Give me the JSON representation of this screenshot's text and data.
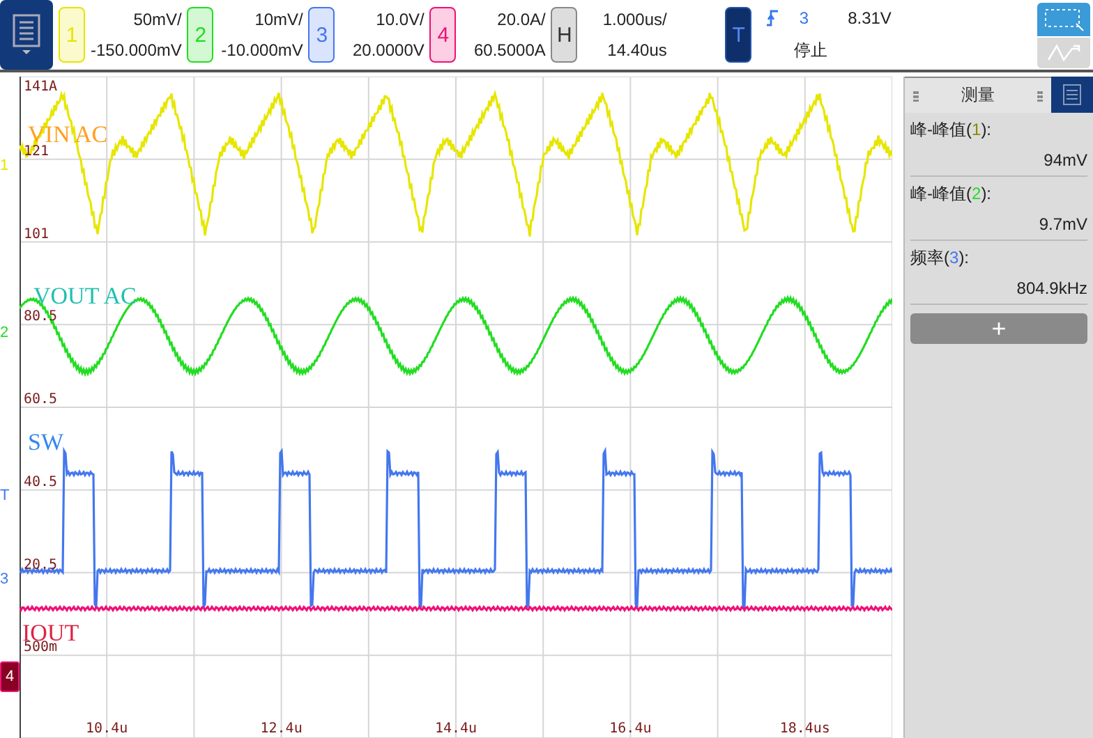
{
  "channels": [
    {
      "number": "1",
      "scale": "50mV/",
      "offset": "-150.000mV",
      "color": "#e6e600"
    },
    {
      "number": "2",
      "scale": "10mV/",
      "offset": "-10.000mV",
      "color": "#22dd22"
    },
    {
      "number": "3",
      "scale": "10.0V/",
      "offset": "20.0000V",
      "color": "#4477ee"
    },
    {
      "number": "4",
      "scale": "20.0A/",
      "offset": "60.5000A",
      "color": "#ee1177"
    }
  ],
  "horizontal": {
    "badge": "H",
    "scale": "1.000us/",
    "position": "14.40us"
  },
  "trigger": {
    "badge": "T",
    "source": "3",
    "level": "8.31V",
    "status": "停止"
  },
  "plot": {
    "trace_labels": [
      {
        "text": "VIN AC",
        "color": "#ffa020"
      },
      {
        "text": "VOUT AC",
        "color": "#20c0b0"
      },
      {
        "text": "SW",
        "color": "#3388ee"
      },
      {
        "text": "IOUT",
        "color": "#dd2244"
      }
    ],
    "grid_labels": [
      "141A",
      "121",
      "101",
      "80.5",
      "60.5",
      "40.5",
      "20.5",
      "500m"
    ],
    "time_labels": [
      "10.4u",
      "12.4u",
      "14.4u",
      "16.4u",
      "18.4us"
    ],
    "markers": [
      {
        "text": "1",
        "color": "#e6e600"
      },
      {
        "text": "2",
        "color": "#22dd22"
      },
      {
        "text": "T",
        "color": "#4477ee"
      },
      {
        "text": "3",
        "color": "#4477ee"
      },
      {
        "text": "4",
        "color": "#ee1177"
      }
    ]
  },
  "measurements": {
    "title": "测量",
    "items": [
      {
        "name": "峰-峰值(",
        "source": "1",
        "suffix": "):",
        "value": "94mV",
        "color": "#8a8a00"
      },
      {
        "name": "峰-峰值(",
        "source": "2",
        "suffix": "):",
        "value": "9.7mV",
        "color": "#22dd22"
      },
      {
        "name": "频率(",
        "source": "3",
        "suffix": "):",
        "value": "804.9kHz",
        "color": "#4477ee"
      }
    ],
    "add": "+"
  }
}
